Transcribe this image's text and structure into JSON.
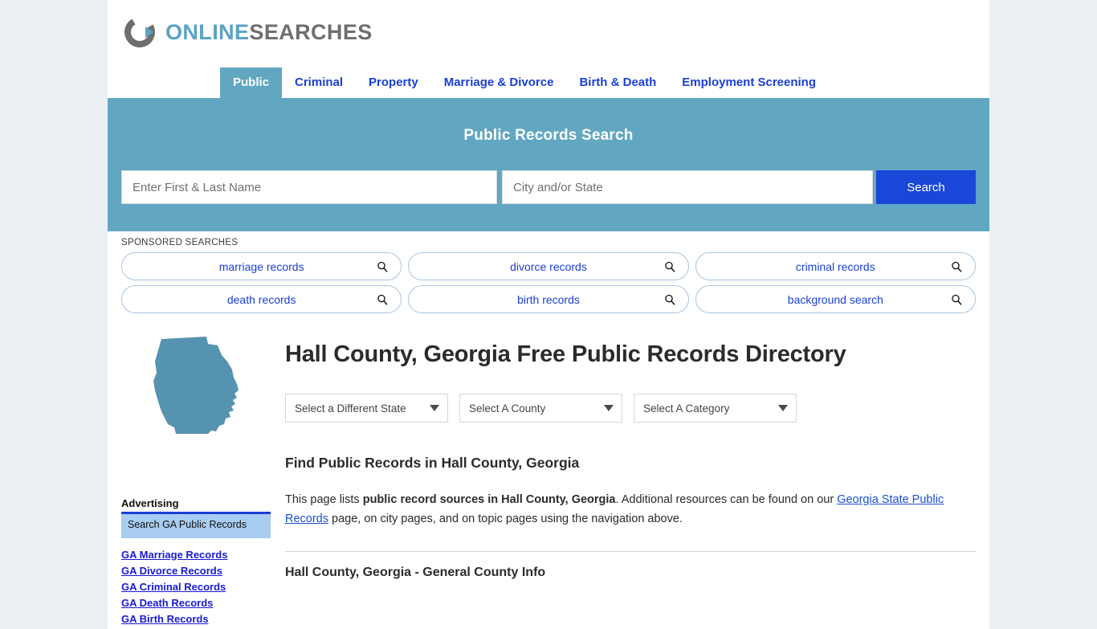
{
  "brand": {
    "name_part1": "ONLINE",
    "name_part2": "SEARCHES",
    "logo_icon": "circular-arrow-logo-icon",
    "accent_blue": "#5ba3c4",
    "accent_gray": "#6e6e6e"
  },
  "nav": {
    "items": [
      {
        "label": "Public",
        "active": true
      },
      {
        "label": "Criminal",
        "active": false
      },
      {
        "label": "Property",
        "active": false
      },
      {
        "label": "Marriage & Divorce",
        "active": false
      },
      {
        "label": "Birth & Death",
        "active": false
      },
      {
        "label": "Employment Screening",
        "active": false
      }
    ]
  },
  "search": {
    "title": "Public Records Search",
    "name_placeholder": "Enter First & Last Name",
    "name_value": "",
    "city_placeholder": "City and/or State",
    "city_value": "",
    "button_label": "Search",
    "banner_color": "#62a7c2",
    "button_color": "#1a47d8"
  },
  "sponsored": {
    "label": "SPONSORED SEARCHES",
    "row1": [
      {
        "label": "marriage records",
        "icon": "search-icon"
      },
      {
        "label": "divorce records",
        "icon": "search-icon"
      },
      {
        "label": "criminal records",
        "icon": "search-icon"
      }
    ],
    "row2": [
      {
        "label": "death records",
        "icon": "search-icon"
      },
      {
        "label": "birth records",
        "icon": "search-icon"
      },
      {
        "label": "background search",
        "icon": "search-icon"
      }
    ]
  },
  "sidebar": {
    "state_map_icon": "georgia-state-map-icon",
    "state_map_color": "#5693b0",
    "advertising_label": "Advertising",
    "ad_box_label": "Search GA Public Records",
    "links": [
      "GA Marriage Records",
      "GA Divorce Records",
      "GA Criminal Records",
      "GA Death Records",
      "GA Birth Records"
    ]
  },
  "main": {
    "page_title": "Hall County, Georgia Free Public Records Directory",
    "selects": [
      {
        "label": "Select a Different State",
        "name": "state"
      },
      {
        "label": "Select A County",
        "name": "county"
      },
      {
        "label": "Select A Category",
        "name": "category"
      }
    ],
    "section_heading": "Find Public Records in Hall County, Georgia",
    "intro": {
      "part1": "This page lists ",
      "bold": "public record sources in Hall County, Georgia",
      "part2": ". Additional resources can be found on our ",
      "link": "Georgia State Public Records",
      "part3": " page, on city pages, and on topic pages using the navigation above."
    },
    "subsection_heading": "Hall County, Georgia - General County Info"
  }
}
